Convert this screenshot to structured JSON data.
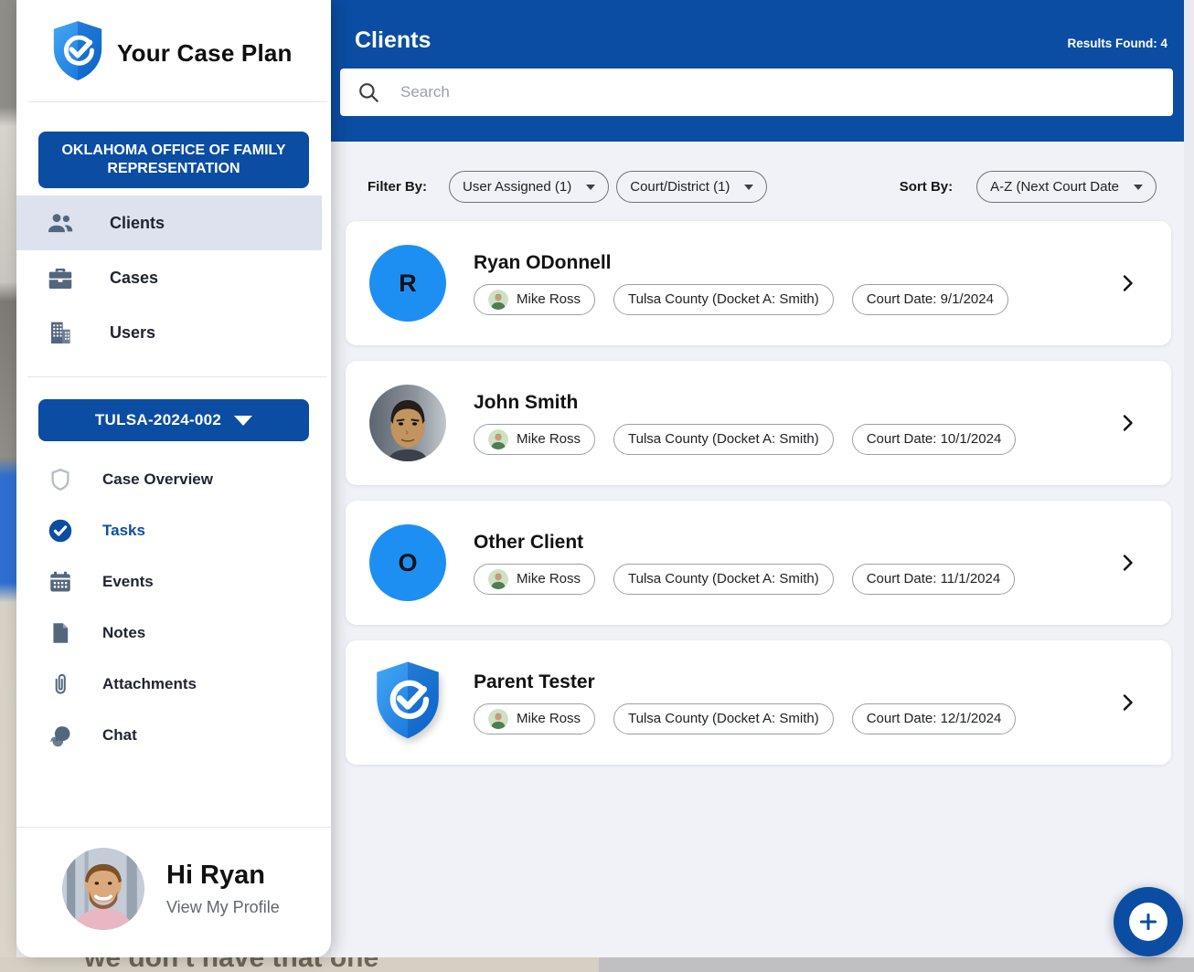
{
  "app": {
    "logo_text": "Your Case Plan",
    "logo_icon": "shield-check-icon"
  },
  "colors": {
    "primary_blue": "#0b4da2",
    "avatar_blue": "#1e8ff2",
    "content_bg": "#f1f2f7",
    "selected_nav_bg": "#dee2ee",
    "icon_slate": "#52677e"
  },
  "sidebar": {
    "org_button_label": "OKLAHOMA OFFICE OF FAMILY REPRESENTATION",
    "nav": [
      {
        "label": "Clients",
        "icon": "people-icon",
        "selected": true
      },
      {
        "label": "Cases",
        "icon": "briefcase-icon",
        "selected": false
      },
      {
        "label": "Users",
        "icon": "building-icon",
        "selected": false
      }
    ],
    "case_selector_label": "TULSA-2024-002",
    "case_nav": [
      {
        "label": "Case Overview",
        "icon": "shield-outline-icon",
        "active": false
      },
      {
        "label": "Tasks",
        "icon": "check-circle-icon",
        "active": true
      },
      {
        "label": "Events",
        "icon": "calendar-icon",
        "active": false
      },
      {
        "label": "Notes",
        "icon": "note-icon",
        "active": false
      },
      {
        "label": "Attachments",
        "icon": "paperclip-icon",
        "active": false
      },
      {
        "label": "Chat",
        "icon": "chat-icon",
        "active": false
      }
    ],
    "profile": {
      "greeting": "Hi Ryan",
      "link_label": "View My Profile",
      "avatar": "ryan-photo"
    }
  },
  "header": {
    "title": "Clients",
    "results_text": "Results Found: 4",
    "search_placeholder": "Search"
  },
  "filters": {
    "filter_by_label": "Filter By:",
    "dropdowns": [
      {
        "label": "User Assigned (1)"
      },
      {
        "label": "Court/District (1)"
      }
    ],
    "sort_by_label": "Sort By:",
    "sort_value": "A-Z (Next Court Date"
  },
  "clients": [
    {
      "name": "Ryan ODonnell",
      "avatar_type": "initial",
      "initial": "R",
      "assignee": "Mike Ross",
      "court": "Tulsa County (Docket A: Smith)",
      "court_date": "Court Date: 9/1/2024"
    },
    {
      "name": "John Smith",
      "avatar_type": "photo",
      "initial": "",
      "assignee": "Mike Ross",
      "court": "Tulsa County (Docket A: Smith)",
      "court_date": "Court Date: 10/1/2024"
    },
    {
      "name": "Other Client",
      "avatar_type": "initial",
      "initial": "O",
      "assignee": "Mike Ross",
      "court": "Tulsa County (Docket A: Smith)",
      "court_date": "Court Date: 11/1/2024"
    },
    {
      "name": "Parent Tester",
      "avatar_type": "logo",
      "initial": "",
      "assignee": "Mike Ross",
      "court": "Tulsa County (Docket A: Smith)",
      "court_date": "Court Date: 12/1/2024"
    }
  ],
  "fab": {
    "icon": "plus-icon"
  },
  "background_page": {
    "partial_text": "we don't have that one"
  }
}
